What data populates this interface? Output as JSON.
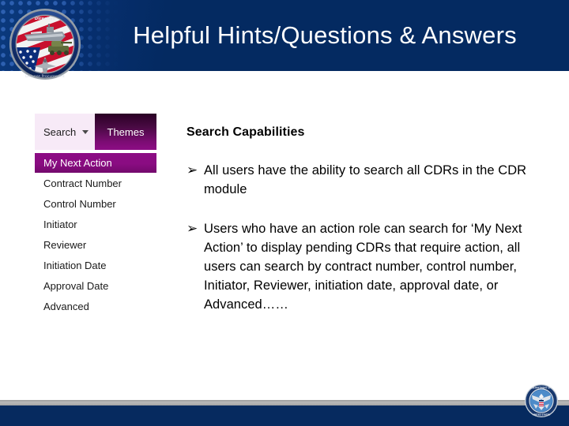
{
  "header": {
    "title": "Helpful Hints/Questions & Answers",
    "seal_icon": "dpap-directive-seal-icon",
    "seal_text_top": "Directive",
    "seal_text_ring": "Defense Procurement and Acquisition Policy",
    "background_color": "#042a61",
    "title_color": "#ffffff",
    "dot_pattern_color": "#2f62b4"
  },
  "search_widget": {
    "tabs": [
      {
        "label": "Search",
        "active": true,
        "caret_icon": "chevron-down-icon"
      },
      {
        "label": "Themes",
        "active": false
      }
    ],
    "menu_items": [
      {
        "label": "My Next Action",
        "selected": true
      },
      {
        "label": "Contract Number",
        "selected": false
      },
      {
        "label": "Control Number",
        "selected": false
      },
      {
        "label": "Initiator",
        "selected": false
      },
      {
        "label": "Reviewer",
        "selected": false
      },
      {
        "label": "Initiation Date",
        "selected": false
      },
      {
        "label": "Approval Date",
        "selected": false
      },
      {
        "label": "Advanced",
        "selected": false
      }
    ],
    "accent_color": "#8c0d84",
    "tab_inactive_color": "#f7eaf7"
  },
  "content": {
    "heading": "Search Capabilities",
    "bullet_glyph": "➢",
    "bullets": [
      "All users have the ability to search all CDRs in the CDR module",
      "Users who have an action role can search for ‘My Next Action’ to display pending CDRs that require action, all users can search by contract number, control number, Initiator, Reviewer, initiation date, approval date, or Advanced……"
    ]
  },
  "footer": {
    "divider_color": "#b9b9b9",
    "bar_color": "#062a5f",
    "seal_icon": "dod-seal-icon",
    "seal_ring_text": "Department of Defense United States of America"
  }
}
